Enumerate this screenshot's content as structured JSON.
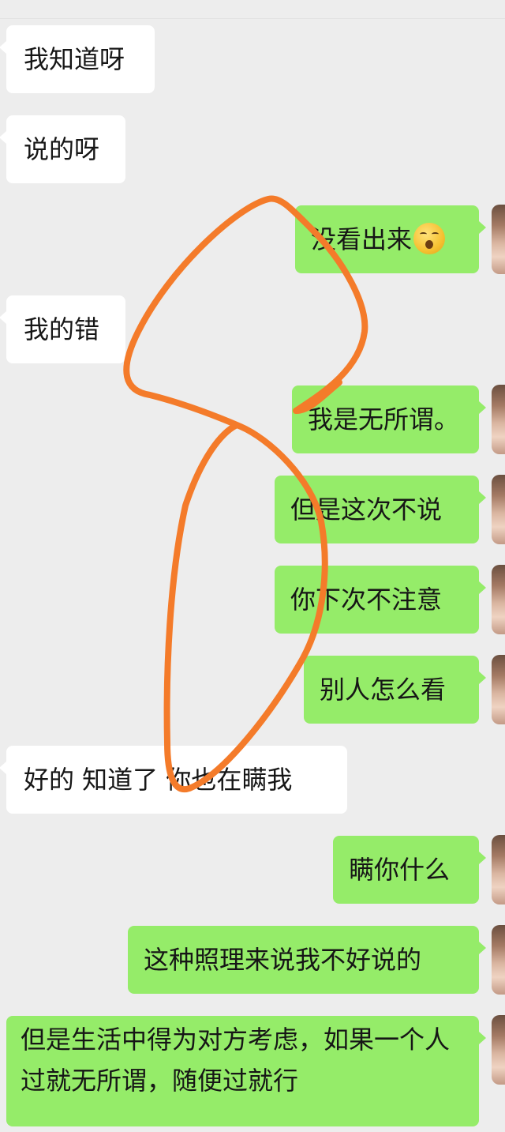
{
  "messages": [
    {
      "side": "in",
      "text": "我知道呀"
    },
    {
      "side": "in",
      "text": "说的呀"
    },
    {
      "side": "out",
      "text": "没看出来",
      "emoji": "kissing-face-emoji"
    },
    {
      "side": "in",
      "text": "我的错"
    },
    {
      "side": "out",
      "text": "我是无所谓。"
    },
    {
      "side": "out",
      "text": "但是这次不说"
    },
    {
      "side": "out",
      "text": "你下次不注意"
    },
    {
      "side": "out",
      "text": "别人怎么看"
    },
    {
      "side": "in",
      "text": "好的 知道了 你也在瞒我"
    },
    {
      "side": "out",
      "text": "瞒你什么"
    },
    {
      "side": "out",
      "text": "这种照理来说我不好说的"
    },
    {
      "side": "out",
      "text": "但是生活中得为对方考虑，如果一个人过就无所谓，随便过就行"
    }
  ],
  "annotation": {
    "color": "#f47b2a",
    "icon": "hand-drawn-circle-annotation"
  }
}
